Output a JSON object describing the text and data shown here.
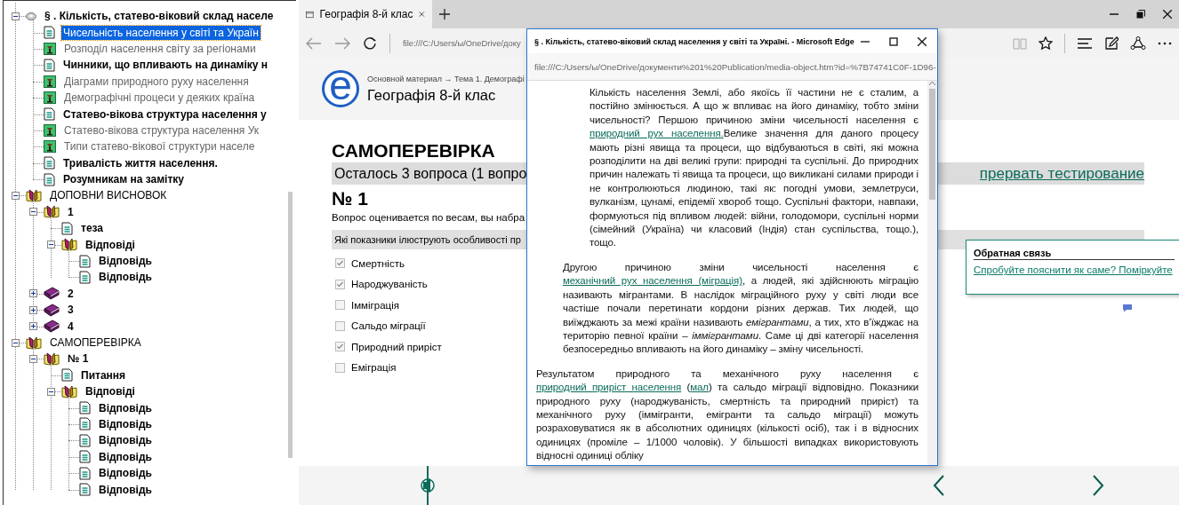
{
  "tree": {
    "items": [
      {
        "label": "§ . Кількість, статево-віковий склад населе",
        "kind": "root",
        "bold": true,
        "selected": false,
        "expanded": true,
        "children": [
          {
            "label": "Чисельність населення у світі та Україн",
            "kind": "page",
            "bold": false,
            "selected": true
          },
          {
            "label": "Розподіл населення світу за регіонами",
            "kind": "media",
            "bold": false,
            "selected": false
          },
          {
            "label": "Чинники, що впливають на динаміку н",
            "kind": "page",
            "bold": true,
            "selected": false
          },
          {
            "label": "Діаграми природного руху населення",
            "kind": "media",
            "bold": false,
            "selected": false
          },
          {
            "label": "Демографічні процеси у деяких країна",
            "kind": "media",
            "bold": false,
            "selected": false
          },
          {
            "label": "Статево-вікова структура населення у",
            "kind": "page",
            "bold": true,
            "selected": false
          },
          {
            "label": "Статево-вікова структура населення Ук",
            "kind": "media",
            "bold": false,
            "selected": false
          },
          {
            "label": "Типи статево-вікової структури населе",
            "kind": "media",
            "bold": false,
            "selected": false
          },
          {
            "label": "Тривалість життя населення.",
            "kind": "page",
            "bold": true,
            "selected": false
          },
          {
            "label": "Розумникам на замітку",
            "kind": "page",
            "bold": true,
            "selected": false
          }
        ]
      },
      {
        "label": "ДОПОВНИ ВИСНОВОК",
        "kind": "folder",
        "bold": false,
        "selected": false,
        "expanded": true,
        "children": [
          {
            "label": "1",
            "kind": "folder",
            "bold": true,
            "selected": false,
            "expanded": true,
            "children": [
              {
                "label": "теза",
                "kind": "page",
                "bold": true,
                "selected": false
              },
              {
                "label": "Відповіді",
                "kind": "folder",
                "bold": true,
                "selected": false,
                "expanded": true,
                "children": [
                  {
                    "label": "Відповідь",
                    "kind": "page",
                    "bold": true,
                    "selected": false
                  },
                  {
                    "label": "Відповідь",
                    "kind": "page",
                    "bold": true,
                    "selected": false
                  }
                ]
              }
            ]
          },
          {
            "label": "2",
            "kind": "book",
            "bold": true,
            "selected": false,
            "expanded": false
          },
          {
            "label": "3",
            "kind": "book",
            "bold": true,
            "selected": false,
            "expanded": false
          },
          {
            "label": "4",
            "kind": "book",
            "bold": true,
            "selected": false,
            "expanded": false
          }
        ]
      },
      {
        "label": "САМОПЕРЕВІРКА",
        "kind": "folder",
        "bold": false,
        "selected": false,
        "expanded": true,
        "children": [
          {
            "label": "№ 1",
            "kind": "folder",
            "bold": true,
            "selected": false,
            "expanded": true,
            "children": [
              {
                "label": "Питання",
                "kind": "page",
                "bold": true,
                "selected": false
              },
              {
                "label": "Відповіді",
                "kind": "folder",
                "bold": true,
                "selected": false,
                "expanded": true,
                "children": [
                  {
                    "label": "Відповідь",
                    "kind": "page",
                    "bold": true,
                    "selected": false
                  },
                  {
                    "label": "Відповідь",
                    "kind": "page",
                    "bold": true,
                    "selected": false
                  },
                  {
                    "label": "Відповідь",
                    "kind": "page",
                    "bold": true,
                    "selected": false
                  },
                  {
                    "label": "Відповідь",
                    "kind": "page",
                    "bold": true,
                    "selected": false
                  },
                  {
                    "label": "Відповідь",
                    "kind": "page",
                    "bold": true,
                    "selected": false
                  },
                  {
                    "label": "Відповідь",
                    "kind": "page",
                    "bold": true,
                    "selected": false
                  }
                ]
              }
            ]
          }
        ]
      }
    ]
  },
  "browser": {
    "tabs": [
      {
        "label": "Географія 8-й клас",
        "selected": true
      }
    ],
    "address": "file:///C:/Users/ы/OneDrive/доку",
    "page": {
      "logo": "e",
      "breadcrumb": "Основной материал → Тема 1. Демографі",
      "site_title": "Географія 8-й клас",
      "heading": "САМОПЕРЕВІРКА",
      "remaining": "Осталось 3 вопроса (1 вопро",
      "abort_link": "прервать тестирование",
      "question_number": "№ 1",
      "scoring_note": "Вопрос оценивается по весам, вы набра",
      "question": "Які показники ілюструють особливості пр",
      "options": [
        {
          "label": "Смертність",
          "checked": true
        },
        {
          "label": "Народжуваність",
          "checked": true
        },
        {
          "label": "Імміграція",
          "checked": false
        },
        {
          "label": "Сальдо міграції",
          "checked": false
        },
        {
          "label": "Природний приріст",
          "checked": true
        },
        {
          "label": "Еміграція",
          "checked": false
        }
      ],
      "feedback": {
        "title": "Обратная связь",
        "link": "Спробуйте пояснити як саме? Поміркуйте"
      }
    }
  },
  "popup": {
    "title": "§ . Кількість, статево-віковий склад населення у світі та Україні. - Microsoft Edge",
    "address": "file:///C:/Users/ы/OneDrive/документи%201%20Publication/media-object.htm?id=%7B74741C0F-1D96-",
    "paragraphs": [
      [
        {
          "kind": "text",
          "text": "Кількість населення Землі, або якоїсь її частини не є сталим, а постійно змінюється. А що ж впливає на його динаміку, тобто зміни чисельності? Першою причиною зміни чисельності населення є "
        },
        {
          "kind": "link",
          "text": "природний рух населення."
        },
        {
          "kind": "text",
          "text": "Велике значення для даного процесу мають різні явища та процеси, що відбуваються в світі, які можна розподілити на дві великі групи: природні та суспільні. До природних причин належать ті явища та процеси, що викликані силами природи і не контролюються людиною, такі як: погодні умови, землетруси, вулканізм, цунамі, епідемії хвороб тощо. Суспільні фактори, навпаки, формуються під впливом людей: війни, голодомори, суспільні норми (сімейний (Україна) чи класовий (Індія) стан суспільства, тощо.), тощо."
        }
      ],
      [
        {
          "kind": "text",
          "text": "Другою причиною зміни чисельності населення є "
        },
        {
          "kind": "link",
          "text": "механічний рух населення (міграція)"
        },
        {
          "kind": "text",
          "text": ", а людей, які здійснюють міграцію називають мігрантами. В наслідок міграційного руху у світі люди все частіше почали перетинати кордони різних держав. Тих людей, що виїжджають за межі країни називають *емігрантами*, а тих, хто в’їжджає на територію певної країни – *іммігрантами*. Саме ці дві категорії населення безпосередньо впливають на його динаміку – зміну чисельності."
        }
      ],
      [
        {
          "kind": "text",
          "text": "Результатом природного та механічного руху населення є "
        },
        {
          "kind": "link",
          "text": "природний приріст населення"
        },
        {
          "kind": "text",
          "text": " ("
        },
        {
          "kind": "link",
          "text": "мал"
        },
        {
          "kind": "text",
          "text": ") та сальдо міграції відповідно. Показники природного руху (народжуваність, смертність та природний приріст) та механічного руху (іммігранти, емігранти та сальдо міграції) можуть розраховуватися як в абсолютних одиницях (кількості осіб), так і в відносних одиницях (проміле – 1/1000 чоловік). У більшості випадках використовують відносні одиниці обліку"
        }
      ]
    ]
  }
}
